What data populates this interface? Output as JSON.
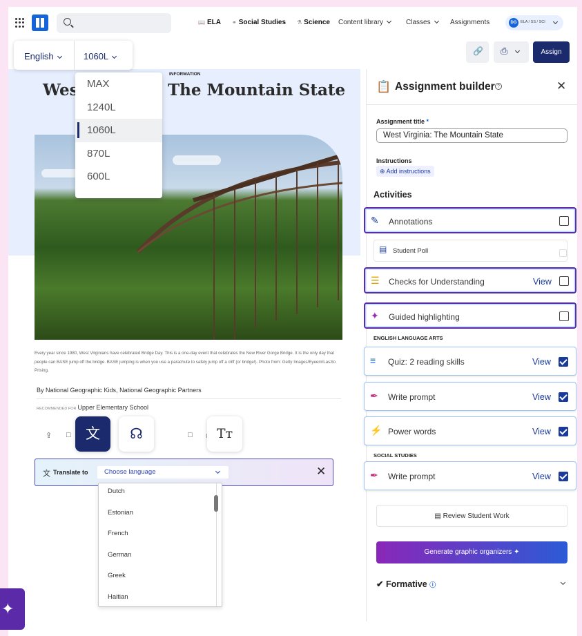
{
  "topbar": {
    "nav": [
      {
        "icon": "book-icon",
        "label": "ELA",
        "bold": true
      },
      {
        "icon": "globe-icon",
        "label": "Social Studies",
        "bold": true
      },
      {
        "icon": "flask-icon",
        "label": "Science",
        "bold": true
      },
      {
        "label": "Content library",
        "dropdown": true
      },
      {
        "label": "Classes",
        "dropdown": true
      },
      {
        "label": "Assignments"
      }
    ],
    "user_initials": "DG",
    "user_subjects": "ELA / SS / SCI"
  },
  "reader_controls": {
    "language": "English",
    "lexile": "1060L",
    "lexile_options": [
      "MAX",
      "1240L",
      "1060L",
      "870L",
      "600L"
    ],
    "assign_label": "Assign"
  },
  "article": {
    "label": "INFORMATION",
    "title_start": "Wes",
    "title_end": "The Mountain State",
    "caption": "Every year since 1980, West Virginians have celebrated Bridge Day. This is a one-day event that celebrates the New River Gorge Bridge. It is the only day that people can BASE jump off the bridge. BASE jumping is when you use a parachute to safely jump off a cliff (or bridge!). Photo from: Getty Images/Eyeem/Laszlo Prising.",
    "byline": "By National Geographic Kids, National Geographic Partners",
    "recommended_label": "RECOMMENDED FOR",
    "recommended_value": "Upper Elementary School"
  },
  "translate": {
    "label": "Translate to",
    "placeholder": "Choose language",
    "languages": [
      "Dutch",
      "Estonian",
      "French",
      "German",
      "Greek",
      "Haitian"
    ]
  },
  "assignment_builder": {
    "title": "Assignment builder",
    "title_field_label": "Assignment title",
    "title_field_value": "West Virginia: The Mountain State",
    "instructions_label": "Instructions",
    "add_instructions": "Add instructions",
    "activities_heading": "Activities",
    "activities": [
      {
        "label": "Annotations",
        "checked": false
      },
      {
        "label": "Student Poll",
        "checked": false
      },
      {
        "label": "Checks for Understanding",
        "view": "View",
        "checked": false
      },
      {
        "label": "Guided highlighting",
        "checked": false
      }
    ],
    "ela_heading": "ENGLISH LANGUAGE ARTS",
    "ela_activities": [
      {
        "label": "Quiz: 2 reading skills",
        "view": "View",
        "checked": true
      },
      {
        "label": "Write prompt",
        "view": "View",
        "checked": true
      },
      {
        "label": "Power words",
        "view": "View",
        "checked": true
      }
    ],
    "ss_heading": "SOCIAL STUDIES",
    "ss_activities": [
      {
        "label": "Write prompt",
        "view": "View",
        "checked": true
      }
    ],
    "review_label": "Review Student Work",
    "generate_label": "Generate graphic organizers",
    "formative_label": "Formative"
  },
  "colors": {
    "brand_navy": "#1a2a6c",
    "brand_blue": "#1565d8",
    "purple_highlight": "#5a2aa8",
    "page_bg": "#fbe4f4"
  }
}
